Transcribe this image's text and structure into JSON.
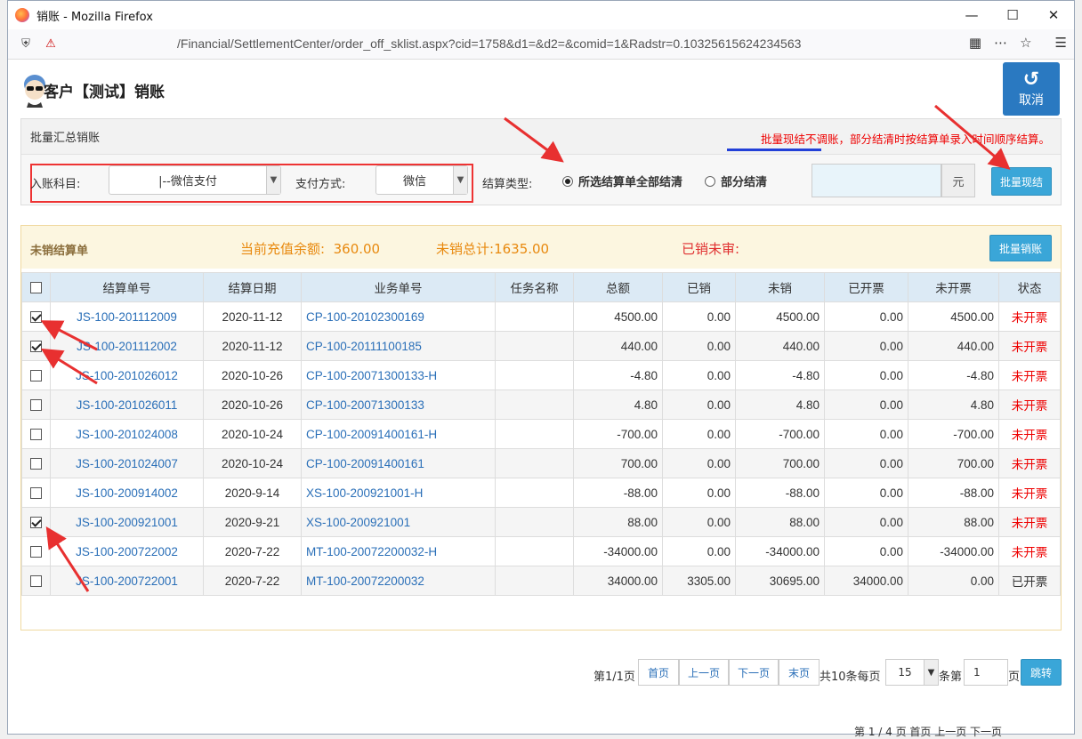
{
  "window": {
    "title": "销账 - Mozilla Firefox",
    "url": "/Financial/SettlementCenter/order_off_sklist.aspx?cid=1758&d1=&d2=&comid=1&Radstr=0.10325615624234563"
  },
  "page": {
    "title": "客户【测试】销账",
    "cancel_label": "取消"
  },
  "batch": {
    "header": "批量汇总销账",
    "notice_prefix": "批量现结不调账",
    "notice_rest": "，部分结清时按结算单录入时间顺序结算。",
    "account_label": "入账科目:",
    "account_value": "|--微信支付",
    "payment_label": "支付方式:",
    "payment_value": "微信",
    "settle_type_label": "结算类型:",
    "option_all": "所选结算单全部结清",
    "option_partial": "部分结清",
    "selected_option": "所选结算单全部结清",
    "amount_value": "",
    "amount_unit": "元",
    "submit_label": "批量现结"
  },
  "unsettled": {
    "header": "未销结算单",
    "balance_label": "当前充值余额:",
    "balance_value": "360.00",
    "total_label": "未销总计:",
    "total_value": "1635.00",
    "unreviewed_label": "已销未审:",
    "batch_button": "批量销账",
    "columns": [
      "结算单号",
      "结算日期",
      "业务单号",
      "任务名称",
      "总额",
      "已销",
      "未销",
      "已开票",
      "未开票",
      "状态"
    ],
    "rows": [
      {
        "checked": true,
        "no": "JS-100-201112009",
        "date": "2020-11-12",
        "biz": "CP-100-20102300169",
        "task": "",
        "total": "4500.00",
        "paid": "0.00",
        "unpaid": "4500.00",
        "invoiced": "0.00",
        "uninvoiced": "4500.00",
        "status": "未开票"
      },
      {
        "checked": true,
        "no": "JS-100-201112002",
        "date": "2020-11-12",
        "biz": "CP-100-20111100185",
        "task": "",
        "total": "440.00",
        "paid": "0.00",
        "unpaid": "440.00",
        "invoiced": "0.00",
        "uninvoiced": "440.00",
        "status": "未开票"
      },
      {
        "checked": false,
        "no": "JS-100-201026012",
        "date": "2020-10-26",
        "biz": "CP-100-20071300133-H",
        "task": "",
        "total": "-4.80",
        "paid": "0.00",
        "unpaid": "-4.80",
        "invoiced": "0.00",
        "uninvoiced": "-4.80",
        "status": "未开票"
      },
      {
        "checked": false,
        "no": "JS-100-201026011",
        "date": "2020-10-26",
        "biz": "CP-100-20071300133",
        "task": "",
        "total": "4.80",
        "paid": "0.00",
        "unpaid": "4.80",
        "invoiced": "0.00",
        "uninvoiced": "4.80",
        "status": "未开票"
      },
      {
        "checked": false,
        "no": "JS-100-201024008",
        "date": "2020-10-24",
        "biz": "CP-100-20091400161-H",
        "task": "",
        "total": "-700.00",
        "paid": "0.00",
        "unpaid": "-700.00",
        "invoiced": "0.00",
        "uninvoiced": "-700.00",
        "status": "未开票"
      },
      {
        "checked": false,
        "no": "JS-100-201024007",
        "date": "2020-10-24",
        "biz": "CP-100-20091400161",
        "task": "",
        "total": "700.00",
        "paid": "0.00",
        "unpaid": "700.00",
        "invoiced": "0.00",
        "uninvoiced": "700.00",
        "status": "未开票"
      },
      {
        "checked": false,
        "no": "JS-100-200914002",
        "date": "2020-9-14",
        "biz": "XS-100-200921001-H",
        "task": "",
        "total": "-88.00",
        "paid": "0.00",
        "unpaid": "-88.00",
        "invoiced": "0.00",
        "uninvoiced": "-88.00",
        "status": "未开票"
      },
      {
        "checked": true,
        "no": "JS-100-200921001",
        "date": "2020-9-21",
        "biz": "XS-100-200921001",
        "task": "",
        "total": "88.00",
        "paid": "0.00",
        "unpaid": "88.00",
        "invoiced": "0.00",
        "uninvoiced": "88.00",
        "status": "未开票"
      },
      {
        "checked": false,
        "no": "JS-100-200722002",
        "date": "2020-7-22",
        "biz": "MT-100-20072200032-H",
        "task": "",
        "total": "-34000.00",
        "paid": "0.00",
        "unpaid": "-34000.00",
        "invoiced": "0.00",
        "uninvoiced": "-34000.00",
        "status": "未开票"
      },
      {
        "checked": false,
        "no": "JS-100-200722001",
        "date": "2020-7-22",
        "biz": "MT-100-20072200032",
        "task": "",
        "total": "34000.00",
        "paid": "3305.00",
        "unpaid": "30695.00",
        "invoiced": "34000.00",
        "uninvoiced": "0.00",
        "status": "已开票"
      }
    ]
  },
  "pager": {
    "page_info": "第1/1页",
    "first": "首页",
    "prev": "上一页",
    "next": "下一页",
    "last": "末页",
    "total_info": "共10条每页",
    "page_size": "15",
    "unit": "条第",
    "page_input": "1",
    "page_suffix": "页",
    "jump": "跳转"
  },
  "background": {
    "bottom_text": "第 1 / 4 页  首页    上一页    下一页"
  },
  "colors": {
    "primary": "#2a79c1",
    "info_button": "#3aa6d8",
    "warning_text": "#e8890e",
    "danger_text": "#e00000",
    "link": "#2a6fb8",
    "annotation_arrow": "#e83030"
  }
}
